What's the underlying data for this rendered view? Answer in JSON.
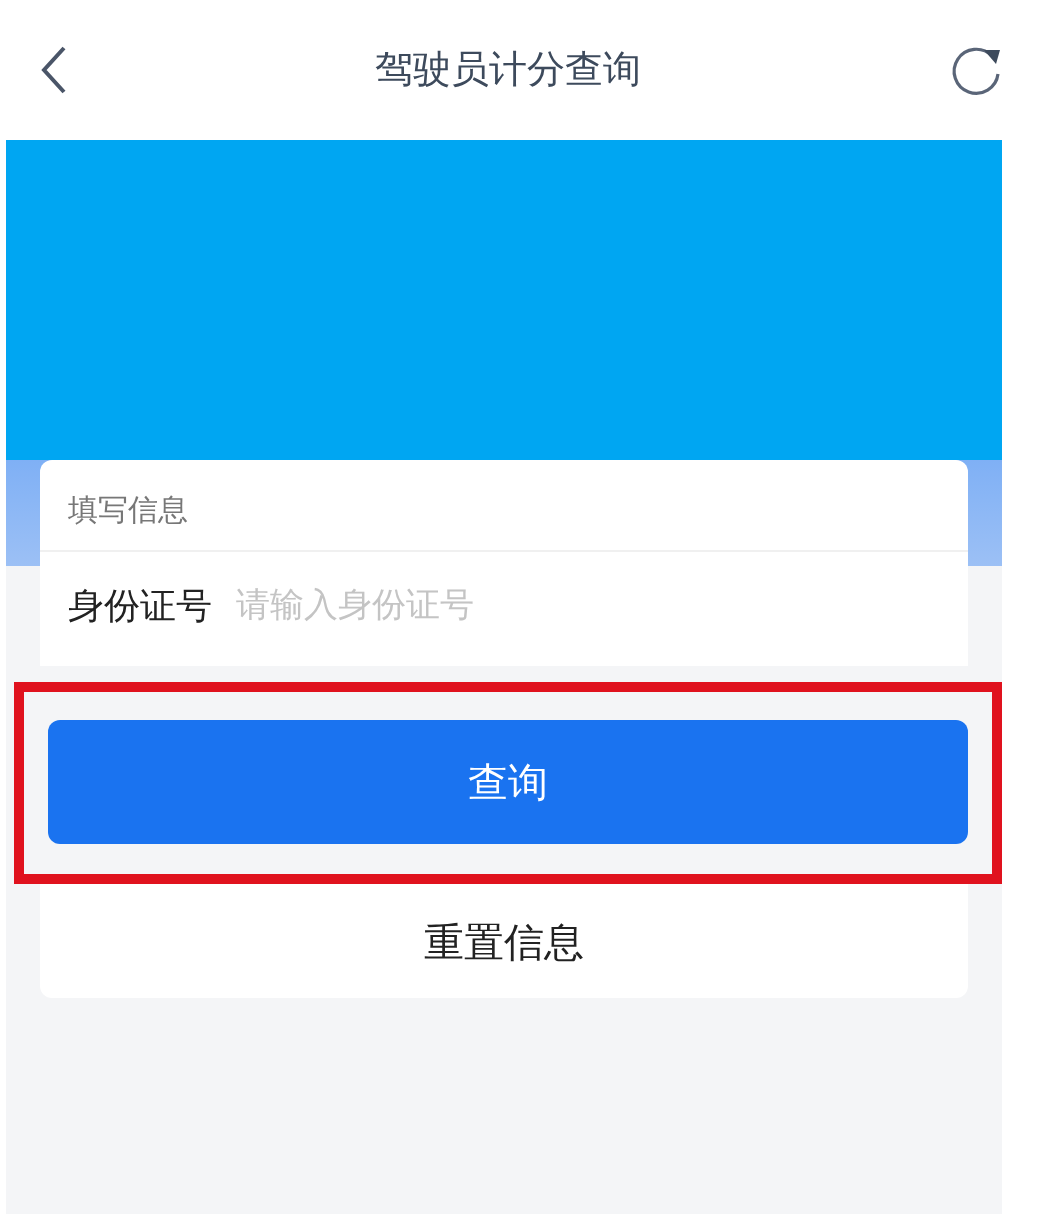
{
  "nav_bar": {
    "title": "驾驶员计分查询"
  },
  "form_card": {
    "section_label": "填写信息",
    "fields": [
      {
        "label": "身份证号",
        "placeholder": "请输入身份证号"
      }
    ]
  },
  "buttons": [
    {
      "label": "查询",
      "kind": "primary",
      "highlighted": true
    },
    {
      "label": "重置信息",
      "kind": "secondary",
      "highlighted": false
    }
  ]
}
